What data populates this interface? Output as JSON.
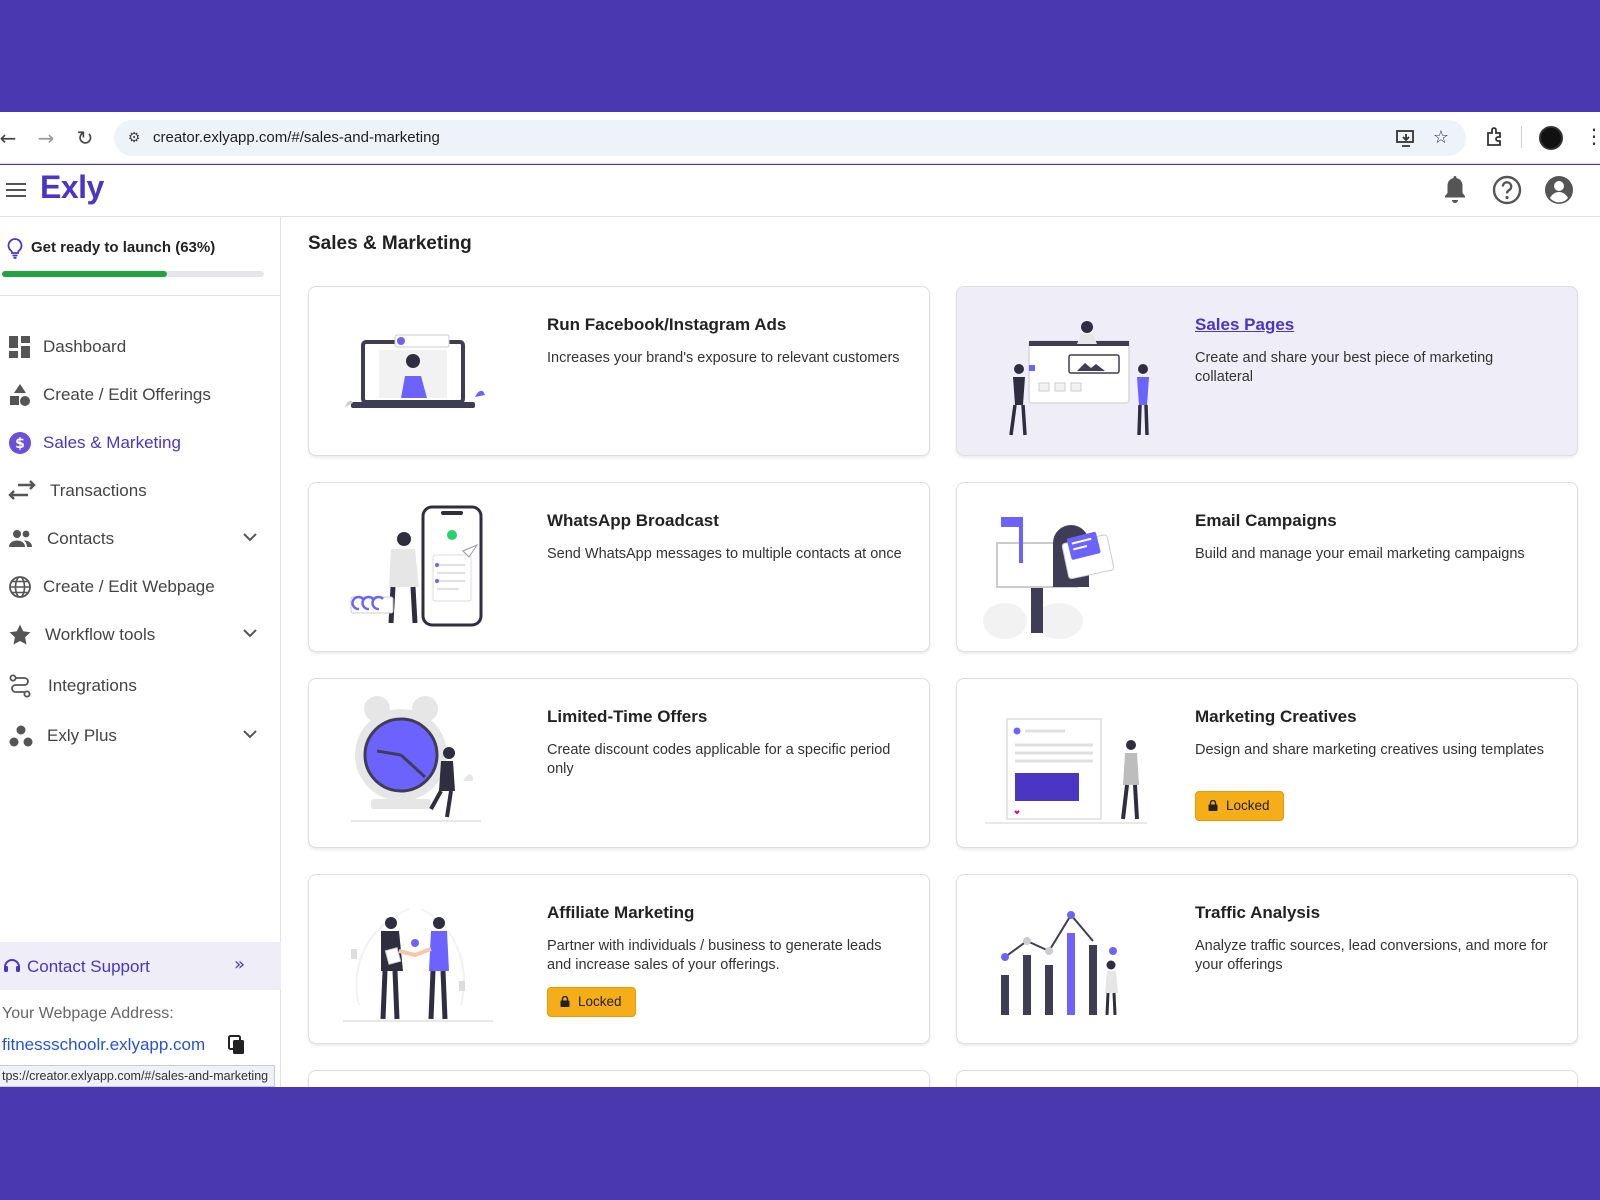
{
  "browser": {
    "url": "creator.exlyapp.com/#/sales-and-marketing",
    "status_url": "tps://creator.exlyapp.com/#/sales-and-marketing"
  },
  "app": {
    "brand": "Exly",
    "colors": {
      "accent": "#4a35c4",
      "progress": "#21a340",
      "locked": "#f5ad18",
      "frame": "#4a38b0"
    }
  },
  "sidebar": {
    "launch_label": "Get ready to launch (63%)",
    "launch_progress": 0.63,
    "items": [
      {
        "label": "Dashboard",
        "icon": "dashboard-icon"
      },
      {
        "label": "Create / Edit Offerings",
        "icon": "shapes-icon"
      },
      {
        "label": "Sales & Marketing",
        "icon": "dollar-icon",
        "active": true
      },
      {
        "label": "Transactions",
        "icon": "swap-arrows-icon"
      },
      {
        "label": "Contacts",
        "icon": "people-icon",
        "expandable": true
      },
      {
        "label": "Create / Edit Webpage",
        "icon": "globe-icon"
      },
      {
        "label": "Workflow tools",
        "icon": "star-icon",
        "expandable": true
      },
      {
        "label": "Integrations",
        "icon": "route-icon"
      },
      {
        "label": "Exly Plus",
        "icon": "dots-cluster-icon",
        "expandable": true
      }
    ],
    "support_label": "Contact Support",
    "webpage_label": "Your Webpage Address:",
    "webpage_url": "fitnessschoolr.exlyapp.com"
  },
  "main": {
    "title": "Sales & Marketing",
    "cards": [
      {
        "title": "Run Facebook/Instagram Ads",
        "desc": "Increases your brand's exposure to relevant customers"
      },
      {
        "title": "Sales Pages",
        "desc": "Create and share your best piece of marketing collateral"
      },
      {
        "title": "WhatsApp Broadcast",
        "desc": "Send WhatsApp messages to multiple contacts at once"
      },
      {
        "title": "Email Campaigns",
        "desc": "Build and manage your email marketing campaigns"
      },
      {
        "title": "Limited-Time Offers",
        "desc": "Create discount codes applicable for a specific period only"
      },
      {
        "title": "Marketing Creatives",
        "desc": "Design and share marketing creatives using templates",
        "badge": "Locked"
      },
      {
        "title": "Affiliate Marketing",
        "desc": "Partner with individuals / business to generate leads and increase sales of your offerings.",
        "badge": "Locked"
      },
      {
        "title": "Traffic Analysis",
        "desc": "Analyze traffic sources, lead conversions, and more for your offerings"
      }
    ]
  }
}
